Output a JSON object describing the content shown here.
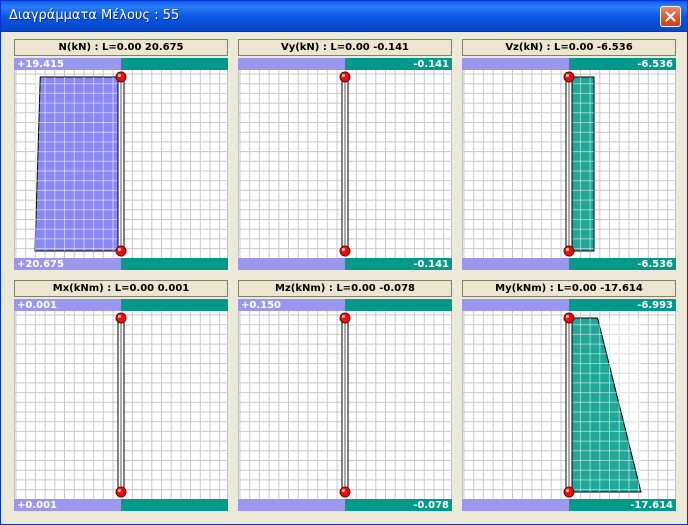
{
  "window": {
    "title": "Διαγράμματα Μέλους : 55",
    "close_icon": "close-icon"
  },
  "colors": {
    "negative_band": "#9a97ee",
    "positive_band": "#00998a",
    "grid_line": "#c8c8c8",
    "fill_N": "#8a89f3",
    "fill_teal": "#1fa898",
    "node": "#e21212"
  },
  "diagrams": [
    {
      "title": "N(kN) : L=0.00 20.675",
      "top_label": "+19.415",
      "bottom_label": "+20.675",
      "side": "left",
      "start_value": 19.415,
      "end_value": 20.675
    },
    {
      "title": "Vy(kN) : L=0.00 -0.141",
      "top_label": "-0.141",
      "bottom_label": "-0.141",
      "side": "right",
      "start_value": -0.141,
      "end_value": -0.141
    },
    {
      "title": "Vz(kN) : L=0.00 -6.536",
      "top_label": "-6.536",
      "bottom_label": "-6.536",
      "side": "right",
      "start_value": -6.536,
      "end_value": -6.536
    },
    {
      "title": "Mx(kNm) : L=0.00 0.001",
      "top_label": "+0.001",
      "bottom_label": "+0.001",
      "side": "left",
      "start_value": 0.001,
      "end_value": 0.001
    },
    {
      "title": "Mz(kNm) : L=0.00 -0.078",
      "top_label": "+0.150",
      "bottom_label": "-0.078",
      "side": "mixed",
      "start_value": 0.15,
      "end_value": -0.078
    },
    {
      "title": "My(kNm) : L=0.00 -17.614",
      "top_label": "-6.993",
      "bottom_label": "-17.614",
      "side": "right",
      "start_value": -6.993,
      "end_value": -17.614
    }
  ]
}
